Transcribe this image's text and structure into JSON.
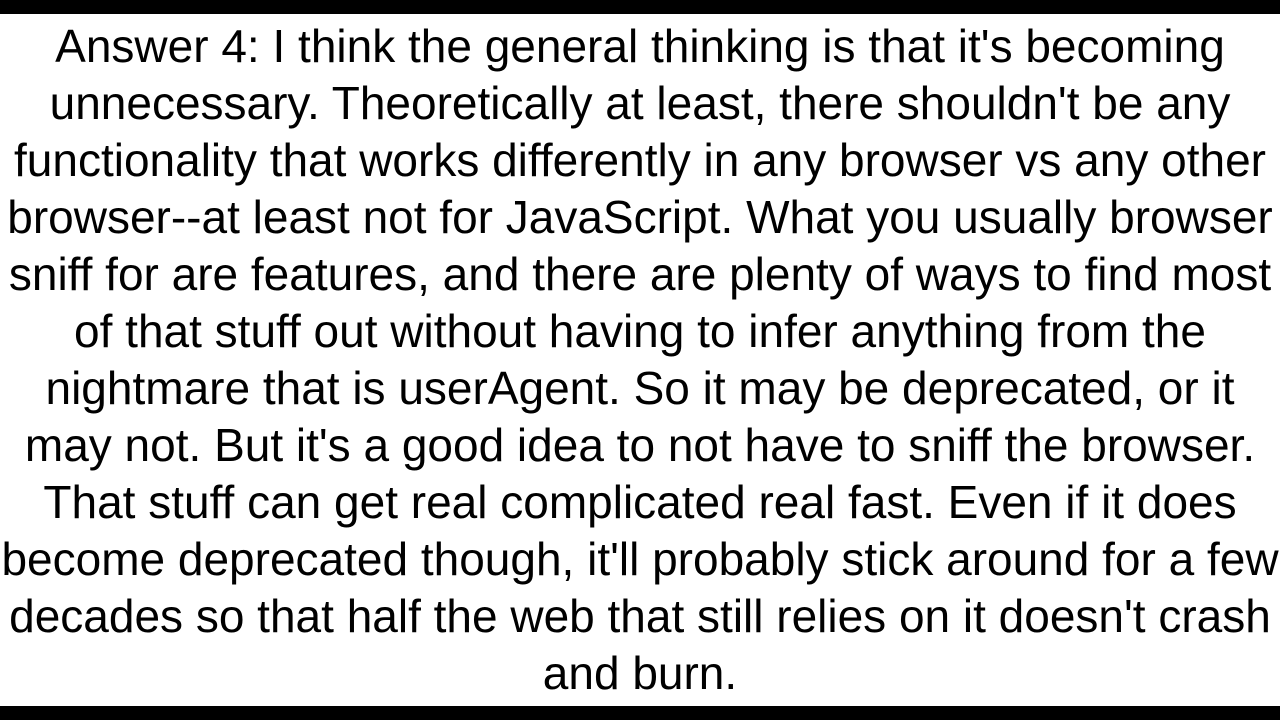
{
  "answer": {
    "label": "Answer 4:",
    "body": "I think the general thinking is that it's becoming unnecessary. Theoretically at least, there shouldn't be any functionality that works differently in any browser vs any other browser--at least not for JavaScript. What you usually browser sniff for are features, and there are plenty of ways to find most of that stuff out without having to infer anything from the nightmare that is userAgent. So it may be deprecated, or it may not. But it's a good idea to not have to sniff the browser. That stuff can get real complicated real fast. Even if it does become deprecated though, it'll probably stick around for a few decades so that half the web that still relies on it doesn't crash and burn."
  }
}
